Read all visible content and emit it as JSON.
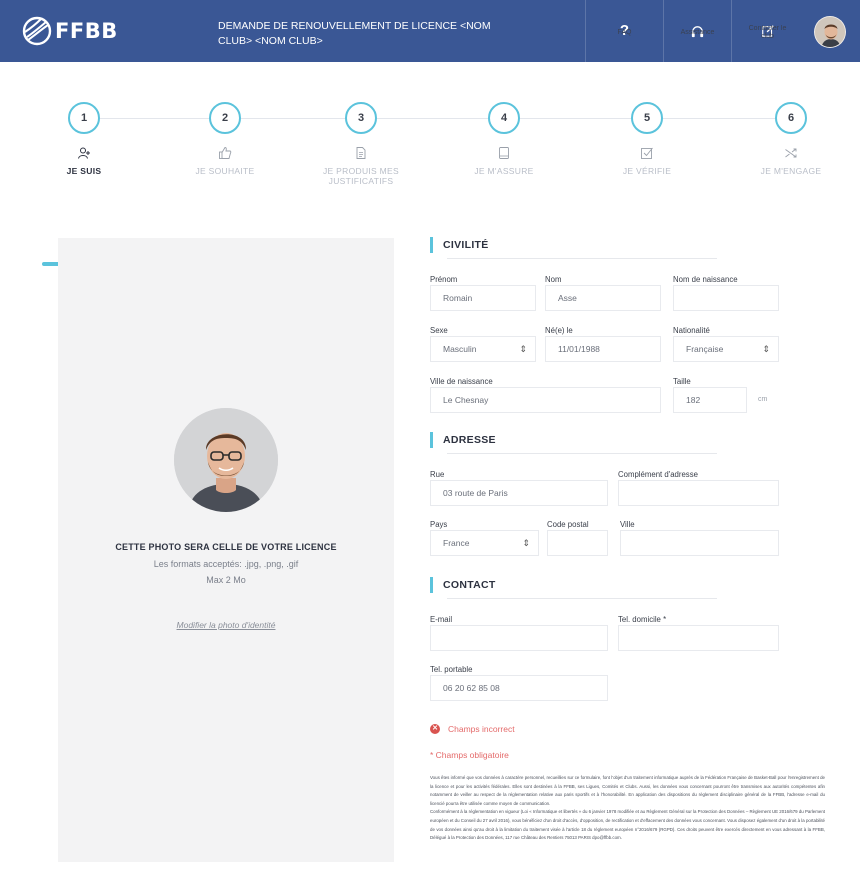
{
  "header": {
    "logo_text": "FFBB",
    "title": "DEMANDE DE RENOUVELLEMENT DE LICENCE <NOM CLUB> <NOM CLUB>",
    "actions": [
      {
        "label": "FAQ",
        "icon": "question-icon"
      },
      {
        "label": "Assistance",
        "icon": "headset-icon"
      },
      {
        "label": "Contacter le club",
        "icon": "edit-icon"
      }
    ],
    "brand_color": "#3a5795"
  },
  "stepper": {
    "accent_color": "#5bc3dc",
    "steps": [
      {
        "number": "1",
        "label": "JE SUIS",
        "icon": "user-plus-icon",
        "active": true
      },
      {
        "number": "2",
        "label": "JE SOUHAITE",
        "icon": "thumbs-up-icon",
        "active": false
      },
      {
        "number": "3",
        "label": "JE PRODUIS MES JUSTIFICATIFS",
        "icon": "document-icon",
        "active": false
      },
      {
        "number": "4",
        "label": "JE M'ASSURE",
        "icon": "tablet-icon",
        "active": false
      },
      {
        "number": "5",
        "label": "JE VÉRIFIE",
        "icon": "checkbox-icon",
        "active": false
      },
      {
        "number": "6",
        "label": "JE M'ENGAGE",
        "icon": "shuffle-icon",
        "active": false
      }
    ]
  },
  "photo_panel": {
    "caption": "CETTE PHOTO SERA CELLE DE VOTRE LICENCE",
    "formats": "Les formats acceptés: .jpg, .png, .gif",
    "max_size": "Max 2 Mo",
    "edit_link": "Modifier la photo d'identité"
  },
  "civilite": {
    "title": "CIVILITÉ",
    "prenom": {
      "label": "Prénom",
      "value": "Romain"
    },
    "nom": {
      "label": "Nom",
      "value": "Asse"
    },
    "nom_naissance": {
      "label": "Nom de naissance",
      "value": ""
    },
    "sexe": {
      "label": "Sexe",
      "value": "Masculin"
    },
    "date_naissance": {
      "label": "Né(e) le",
      "value": "11/01/1988"
    },
    "nationalite": {
      "label": "Nationalité",
      "value": "Française"
    },
    "ville_naissance": {
      "label": "Ville de naissance",
      "value": "Le Chesnay"
    },
    "taille": {
      "label": "Taille",
      "value": "182",
      "unit": "cm"
    }
  },
  "adresse": {
    "title": "ADRESSE",
    "rue": {
      "label": "Rue",
      "value": "03 route de Paris"
    },
    "complement": {
      "label": "Complément d'adresse",
      "value": ""
    },
    "pays": {
      "label": "Pays",
      "value": "France"
    },
    "code_postal": {
      "label": "Code postal",
      "value": ""
    },
    "ville": {
      "label": "Ville",
      "value": ""
    }
  },
  "contact": {
    "title": "CONTACT",
    "email": {
      "label": "E-mail",
      "value": ""
    },
    "tel_domicile": {
      "label": "Tel. domicile *",
      "value": ""
    },
    "tel_portable": {
      "label": "Tel. portable",
      "value": "06 20 62 85 08"
    }
  },
  "messages": {
    "error": "Champs incorrect",
    "required": "* Champs obligatoire",
    "error_color": "#d9534f"
  },
  "legal": {
    "p1": "Vous êtes informé que vos données à caractère personnel, recueillies sur ce formulaire, font l'objet d'un traitement informatique auprès de la Fédération Française de Basket-Ball pour l'enregistrement de la licence et pour les activités fédérales. Elles sont destinées à la FFBB, ses Ligues, Comités et Clubs. Aussi, les données vous concernant pourront être transmises aux autorités compétentes afin notamment de veiller au respect de la réglementation relative aux paris sportifs et à l'honorabilité. En application des dispositions du règlement disciplinaire général de la FFBB, l'adresse e-mail du licencié pourra être utilisée comme moyen de communication.",
    "p2": "Conformément à la réglementation en vigueur (Loi « Informatique et libertés » du 6 janvier 1978 modifiée et au Règlement Général sur la Protection des Données – Règlement UE 2016/679 du Parlement européen et du Conseil du 27 avril 2016), vous bénéficiez d'un droit d'accès, d'opposition, de rectification et d'effacement des données vous concernant. Vous disposez également d'un droit à la portabilité de vos données ainsi qu'au droit à la limitation du traitement visée à l'article 18 du règlement européen n°2016/679 (RGPD). Ces droits peuvent être exercés directement en vous adressant à la FFBB, Délégué à la Protection des Données, 117 rue Château des Rentiers 75013 PARIS dpo@ffbb.com."
  }
}
